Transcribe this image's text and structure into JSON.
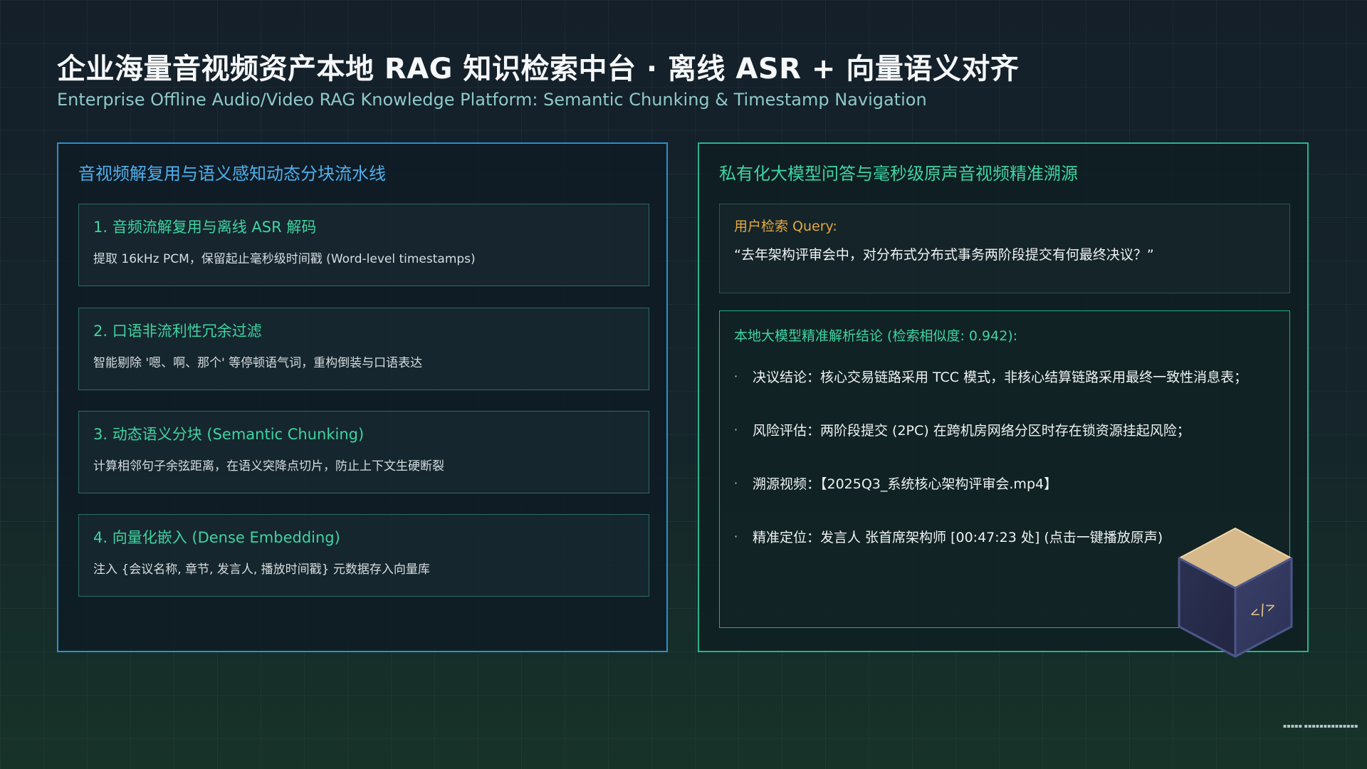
{
  "header": {
    "title": "企业海量音视频资产本地 RAG 知识检索中台 ·   离线 ASR + 向量语义对齐",
    "subtitle": "Enterprise Offline Audio/Video RAG Knowledge Platform: Semantic Chunking & Timestamp Navigation"
  },
  "left_panel": {
    "title": "音视频解复用与语义感知动态分块流水线",
    "steps": [
      {
        "title": "1. 音频流解复用与离线 ASR 解码",
        "desc": "提取 16kHz PCM，保留起止毫秒级时间戳 (Word-level timestamps)"
      },
      {
        "title": "2. 口语非流利性冗余过滤",
        "desc": "智能剔除 '嗯、啊、那个' 等停顿语气词，重构倒装与口语表达"
      },
      {
        "title": "3. 动态语义分块 (Semantic Chunking)",
        "desc": "计算相邻句子余弦距离，在语义突降点切片，防止上下文生硬断裂"
      },
      {
        "title": "4. 向量化嵌入 (Dense Embedding)",
        "desc": "注入 {会议名称, 章节, 发言人, 播放时间戳} 元数据存入向量库"
      }
    ]
  },
  "right_panel": {
    "title": "私有化大模型问答与毫秒级原声音视频精准溯源",
    "query": {
      "label": "用户检索 Query:",
      "text": "“去年架构评审会中，对分布式分布式事务两阶段提交有何最终决议？”"
    },
    "answer": {
      "heading": "本地大模型精准解析结论 (检索相似度: 0.942):",
      "bullet_symbol": "·",
      "bullets": [
        "决议结论：核心交易链路采用 TCC 模式，非核心结算链路采用最终一致性消息表；",
        "风险评估：两阶段提交 (2PC) 在跨机房网络分区时存在锁资源挂起风险；",
        "溯源视频：【2025Q3_系统核心架构评审会.mp4】",
        "精准定位：发言人 张首席架构师 [00:47:23 处] (点击一键播放原声)"
      ]
    }
  },
  "decoration": {
    "cube_icon": "code-cube-icon",
    "cube_glyph": "</>"
  },
  "footer": {
    "note": "▪▪▪▪▪ ▪▪▪▪▪▪▪▪▪▪▪▪▪▪"
  },
  "colors": {
    "accent_blue": "#2f8fc8",
    "accent_green": "#3ed4a2",
    "accent_orange": "#e5a83e",
    "background": "#13202a"
  }
}
